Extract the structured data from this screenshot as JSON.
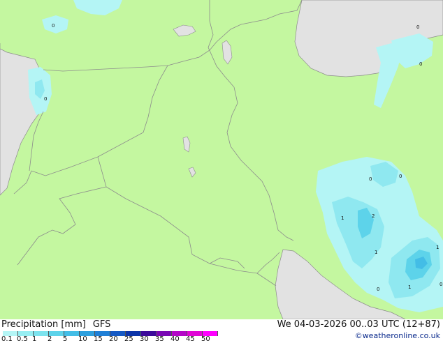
{
  "legend": {
    "title": "Precipitation [mm]",
    "model": "GFS",
    "valid_time": "We 04-03-2026 00..03 UTC (12+87)",
    "credit": "©weatheronline.co.uk",
    "scale_labels": [
      "0.1",
      "0.5",
      "1",
      "2",
      "5",
      "10",
      "15",
      "20",
      "25",
      "30",
      "35",
      "40",
      "45",
      "50"
    ],
    "scale_colors": [
      "#b4f5f5",
      "#96eef2",
      "#7ce3ee",
      "#5dd3ea",
      "#43bde6",
      "#2ea0de",
      "#1f7fd6",
      "#1559c4",
      "#0c34a8",
      "#3c0a9a",
      "#7a08b4",
      "#b406c8",
      "#e006d6",
      "#ff00ff"
    ]
  },
  "map": {
    "colors": {
      "land": "#c4f7a0",
      "sea": "#e2e2e2",
      "border": "#8c8c8c",
      "precip_light": "#b4f5f5",
      "precip_mid": "#8fe8f0",
      "precip_strong": "#5dd3ea",
      "precip_core": "#43bde6"
    },
    "value_labels": [
      "0",
      "0",
      "0",
      "0",
      "0",
      "0",
      "1",
      "2",
      "1",
      "1",
      "1",
      "0",
      "0"
    ]
  }
}
